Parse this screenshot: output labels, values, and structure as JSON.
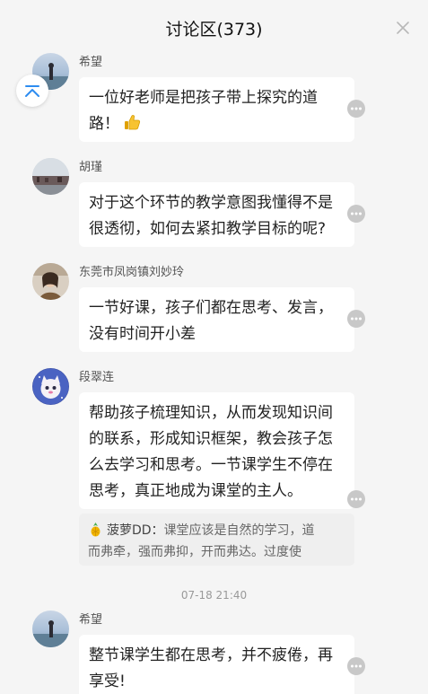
{
  "header": {
    "title": "讨论区(373)"
  },
  "comments": [
    {
      "username": "希望",
      "text_line1": "一位好老师是把孩子带上探究的道",
      "text_line2": "路！"
    },
    {
      "username": "胡瑾",
      "text_line1": "对于这个环节的教学意图我懂得不是",
      "text_line2": "很透彻，如何去紧扣教学目标的呢?"
    },
    {
      "username": "东莞市凤岗镇刘妙玲",
      "text_line1": "一节好课，孩子们都在思考、发言，",
      "text_line2": "没有时间开小差"
    },
    {
      "username": "段翠连",
      "text_line1": "帮助孩子梳理知识，从而发现知识间",
      "text_line2": "的联系，形成知识框架，教会孩子怎",
      "text_line3": "么去学习和思考。一节课学生不停在",
      "text_line4": "思考，真正地成为课堂的主人。",
      "reply_name": "菠萝DD：",
      "reply_line1": "课堂应该是自然的学习，道",
      "reply_line2": "而弗牵，强而弗抑，开而弗达。过度使"
    },
    {
      "username": "希望",
      "text_line1": "整节课学生都在思考，并不疲倦，再",
      "text_line2": "享受!"
    }
  ],
  "timestamp": "07-18 21:40",
  "icons": {
    "close": "close-icon",
    "back_to_top": "chevron-up-icon",
    "more": "more-icon",
    "thumbs_up": "thumbs-up-icon",
    "pineapple": "pineapple-icon"
  },
  "colors": {
    "background": "#f5f5f5",
    "bubble": "#ffffff",
    "accent": "#2d8cf0"
  }
}
